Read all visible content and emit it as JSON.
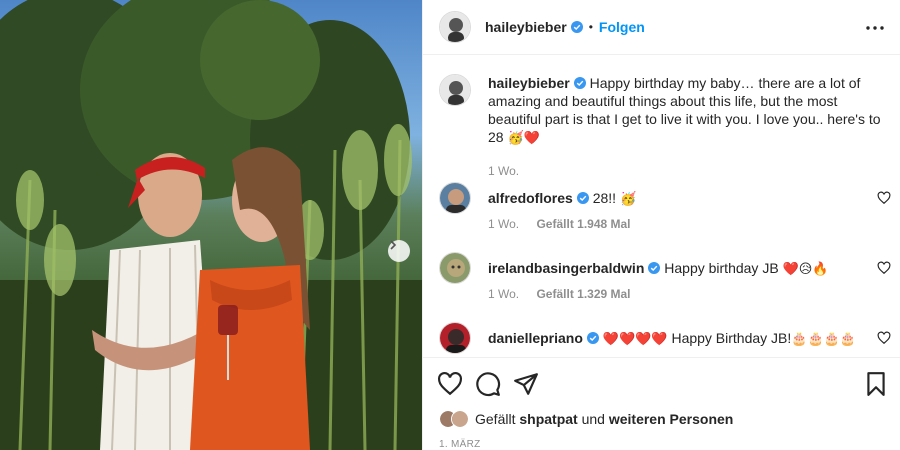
{
  "post": {
    "username": "haileybieber",
    "follow_label": "Folgen",
    "separator": "•"
  },
  "caption": {
    "username": "haileybieber",
    "text": "Happy birthday my baby… there are a lot of amazing and beautiful things about this life, but the most beautiful part is that I get to live it with you. I love you.. here's to 28",
    "emojis": "🥳❤️",
    "time": "1 Wo."
  },
  "comments": [
    {
      "username": "alfredoflores",
      "text": "28!!",
      "emojis": "🥳",
      "time": "1 Wo.",
      "likes": "Gefällt 1.948 Mal"
    },
    {
      "username": "irelandbasingerbaldwin",
      "text": "Happy birthday JB",
      "emojis": "❤️😥🔥",
      "time": "1 Wo.",
      "likes": "Gefällt 1.329 Mal"
    },
    {
      "username": "daniellepriano",
      "text": "Happy Birthday JB!",
      "emojis_before": "❤️❤️❤️❤️",
      "emojis": "🎂🎂🎂🎂"
    }
  ],
  "footer": {
    "liked_prefix": "Gefällt",
    "liked_user": "shpatpat",
    "liked_middle": "und",
    "liked_suffix": "weiteren Personen",
    "date": "1. MÄRZ"
  },
  "icons": {
    "verified": "verified-badge-icon",
    "more": "more-options-icon",
    "like": "heart-icon",
    "comment": "comment-icon",
    "share": "share-icon",
    "save": "bookmark-icon",
    "next": "chevron-right-icon"
  },
  "colors": {
    "accent": "#0095f6",
    "muted": "#8e8e8e",
    "text": "#262626",
    "heart": "#ed4956"
  }
}
